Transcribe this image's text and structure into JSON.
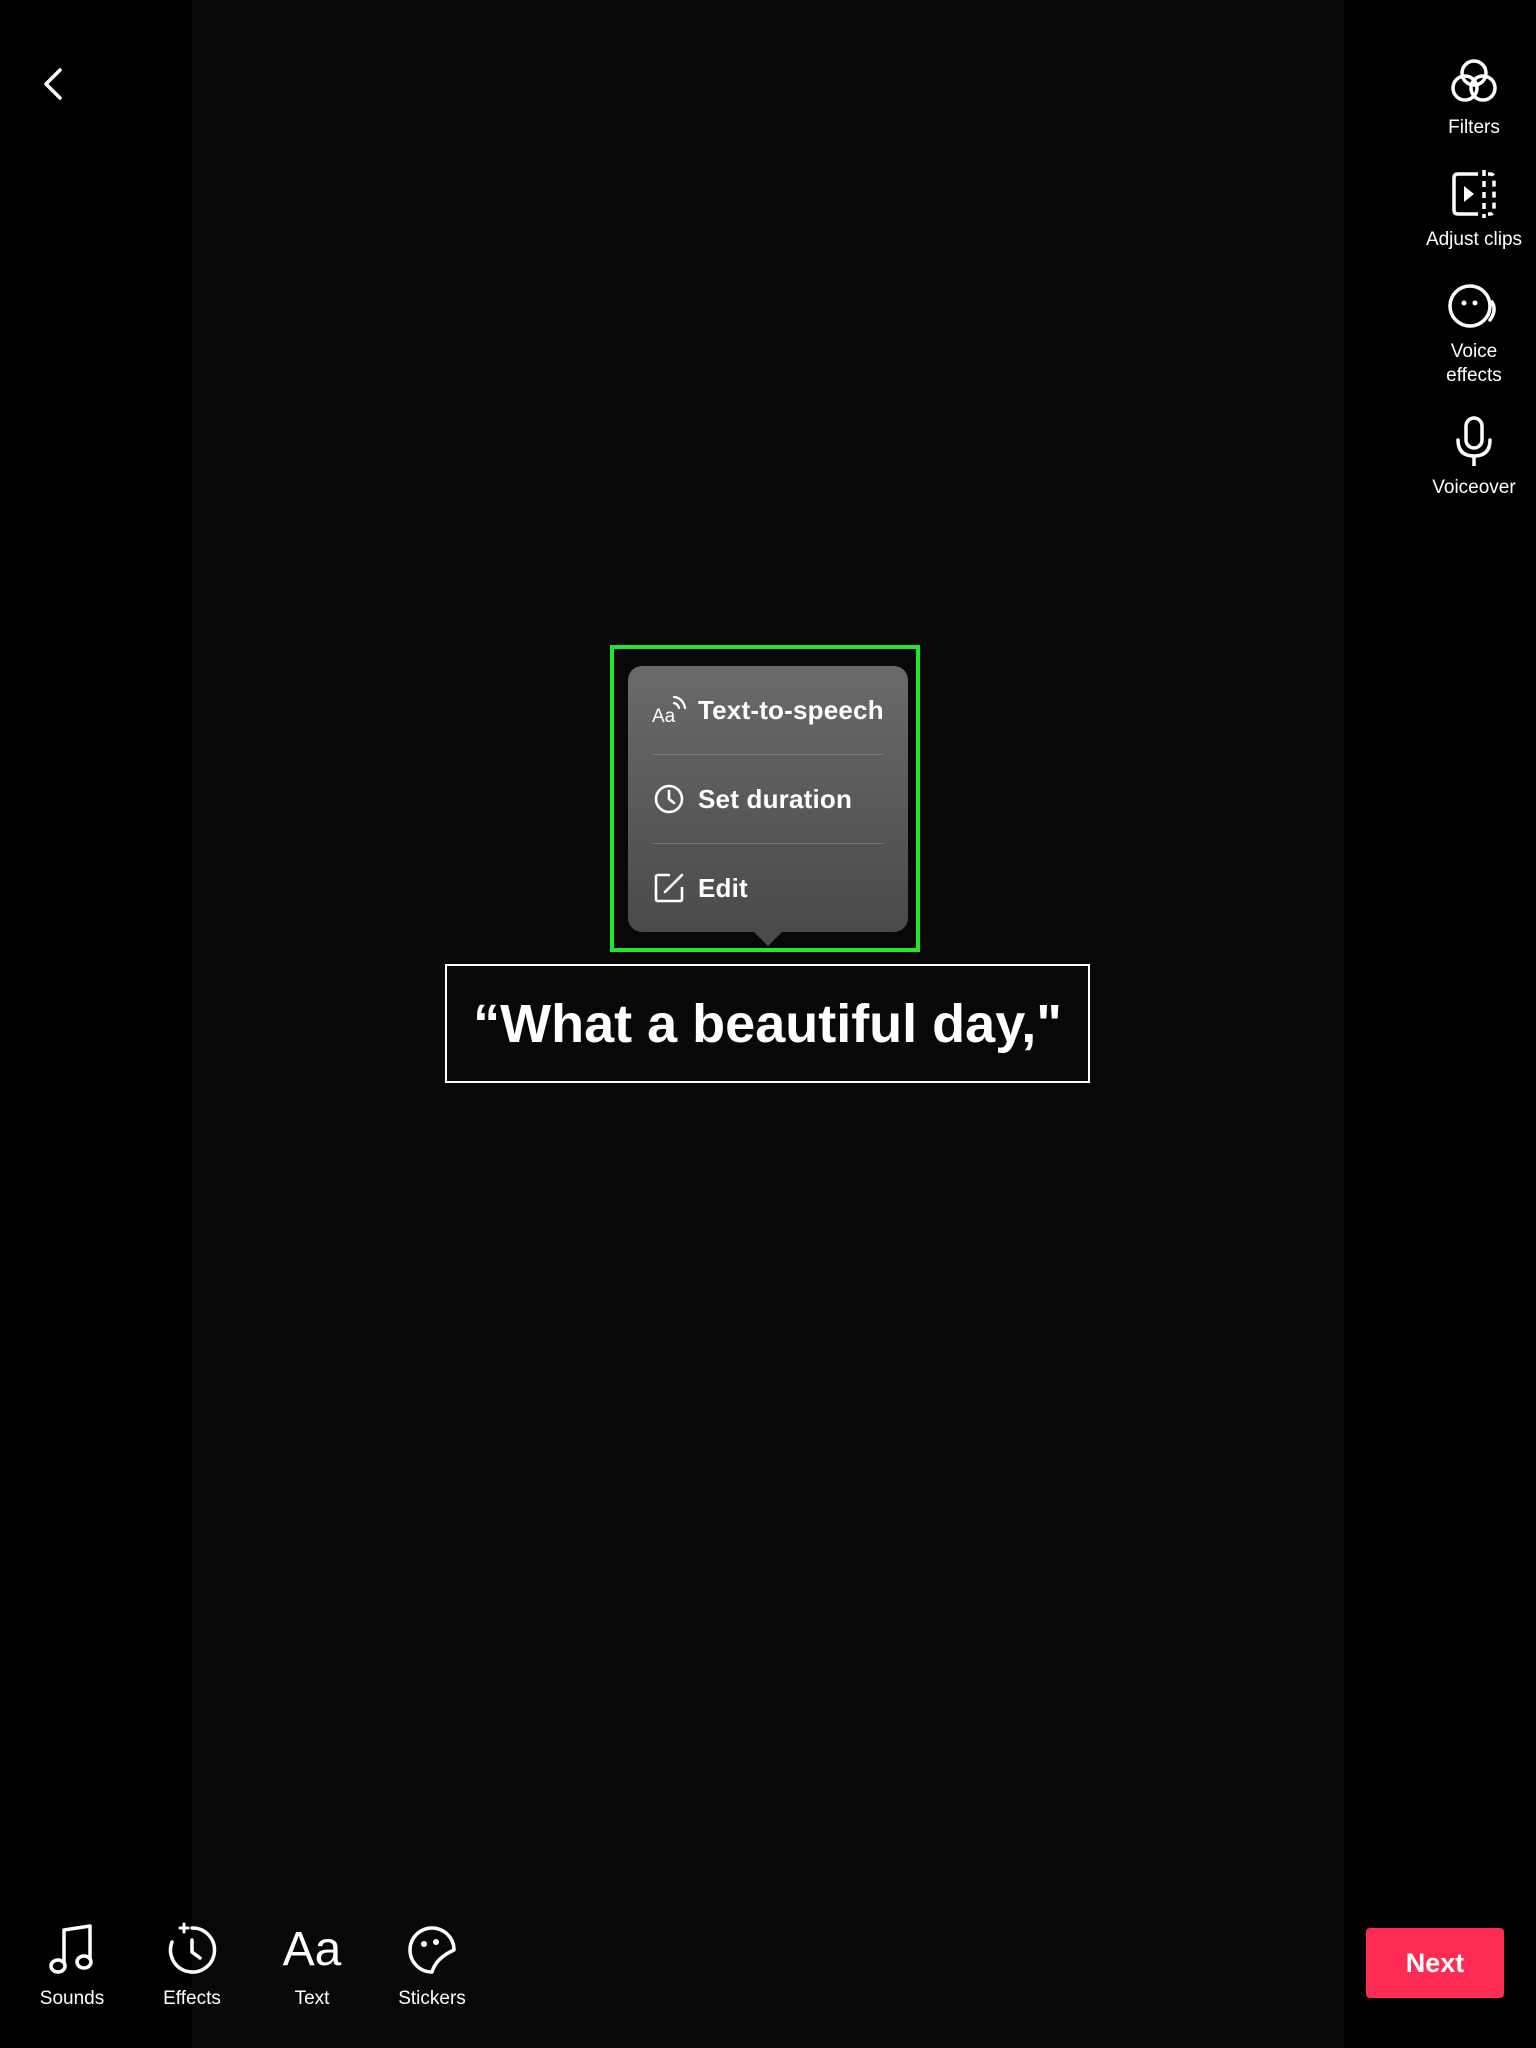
{
  "side_tools": [
    {
      "label": "Filters",
      "icon": "filters-icon"
    },
    {
      "label": "Adjust clips",
      "icon": "adjust-clips-icon"
    },
    {
      "label": "Voice\neffects",
      "icon": "voice-effects-icon"
    },
    {
      "label": "Voiceover",
      "icon": "microphone-icon"
    }
  ],
  "popup_menu": {
    "items": [
      {
        "label": "Text-to-speech",
        "icon": "text-to-speech-icon"
      },
      {
        "label": "Set duration",
        "icon": "clock-icon"
      },
      {
        "label": "Edit",
        "icon": "edit-icon"
      }
    ]
  },
  "caption": {
    "text": "“What a beautiful day,\""
  },
  "bottom_tools": [
    {
      "label": "Sounds",
      "icon": "music-note-icon"
    },
    {
      "label": "Effects",
      "icon": "effects-icon"
    },
    {
      "label": "Text",
      "icon": "text-icon",
      "glyph": "Aa"
    },
    {
      "label": "Stickers",
      "icon": "sticker-icon"
    }
  ],
  "next_button": {
    "label": "Next"
  },
  "colors": {
    "accent": "#fe2c55",
    "highlight": "#1ee82a",
    "popup": "#5a5a5a"
  }
}
